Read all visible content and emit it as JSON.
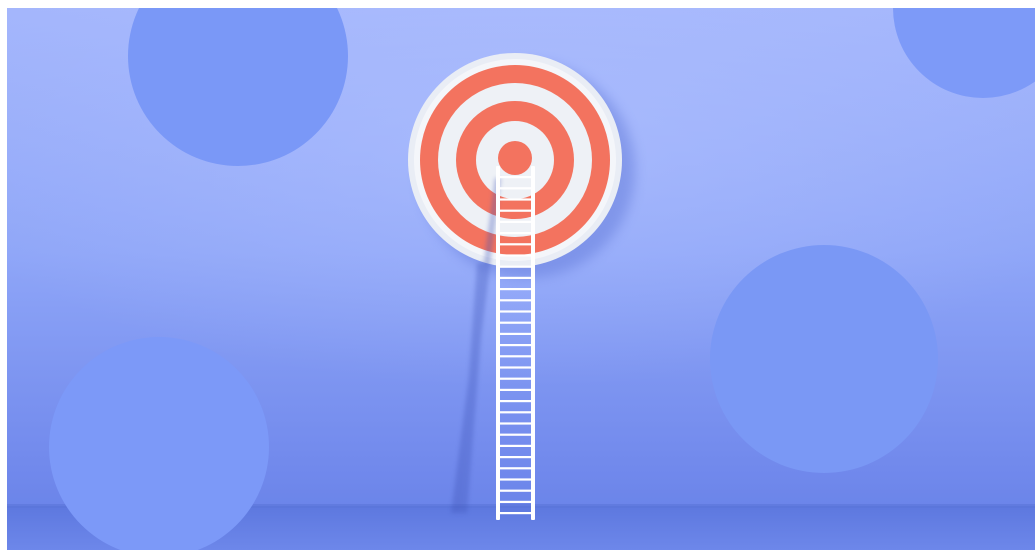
{
  "scene": {
    "colors": {
      "wall_top": "#9fb2fb",
      "wall_mid": "#7f98f3",
      "wall_bottom": "#6680e6",
      "floor": "#5f7be0",
      "circle": "#7796f6",
      "target_red": "#f3735f",
      "target_white": "#eef1f6",
      "ladder": "#ffffff"
    },
    "icons": [
      "target-icon",
      "ladder-icon"
    ]
  }
}
